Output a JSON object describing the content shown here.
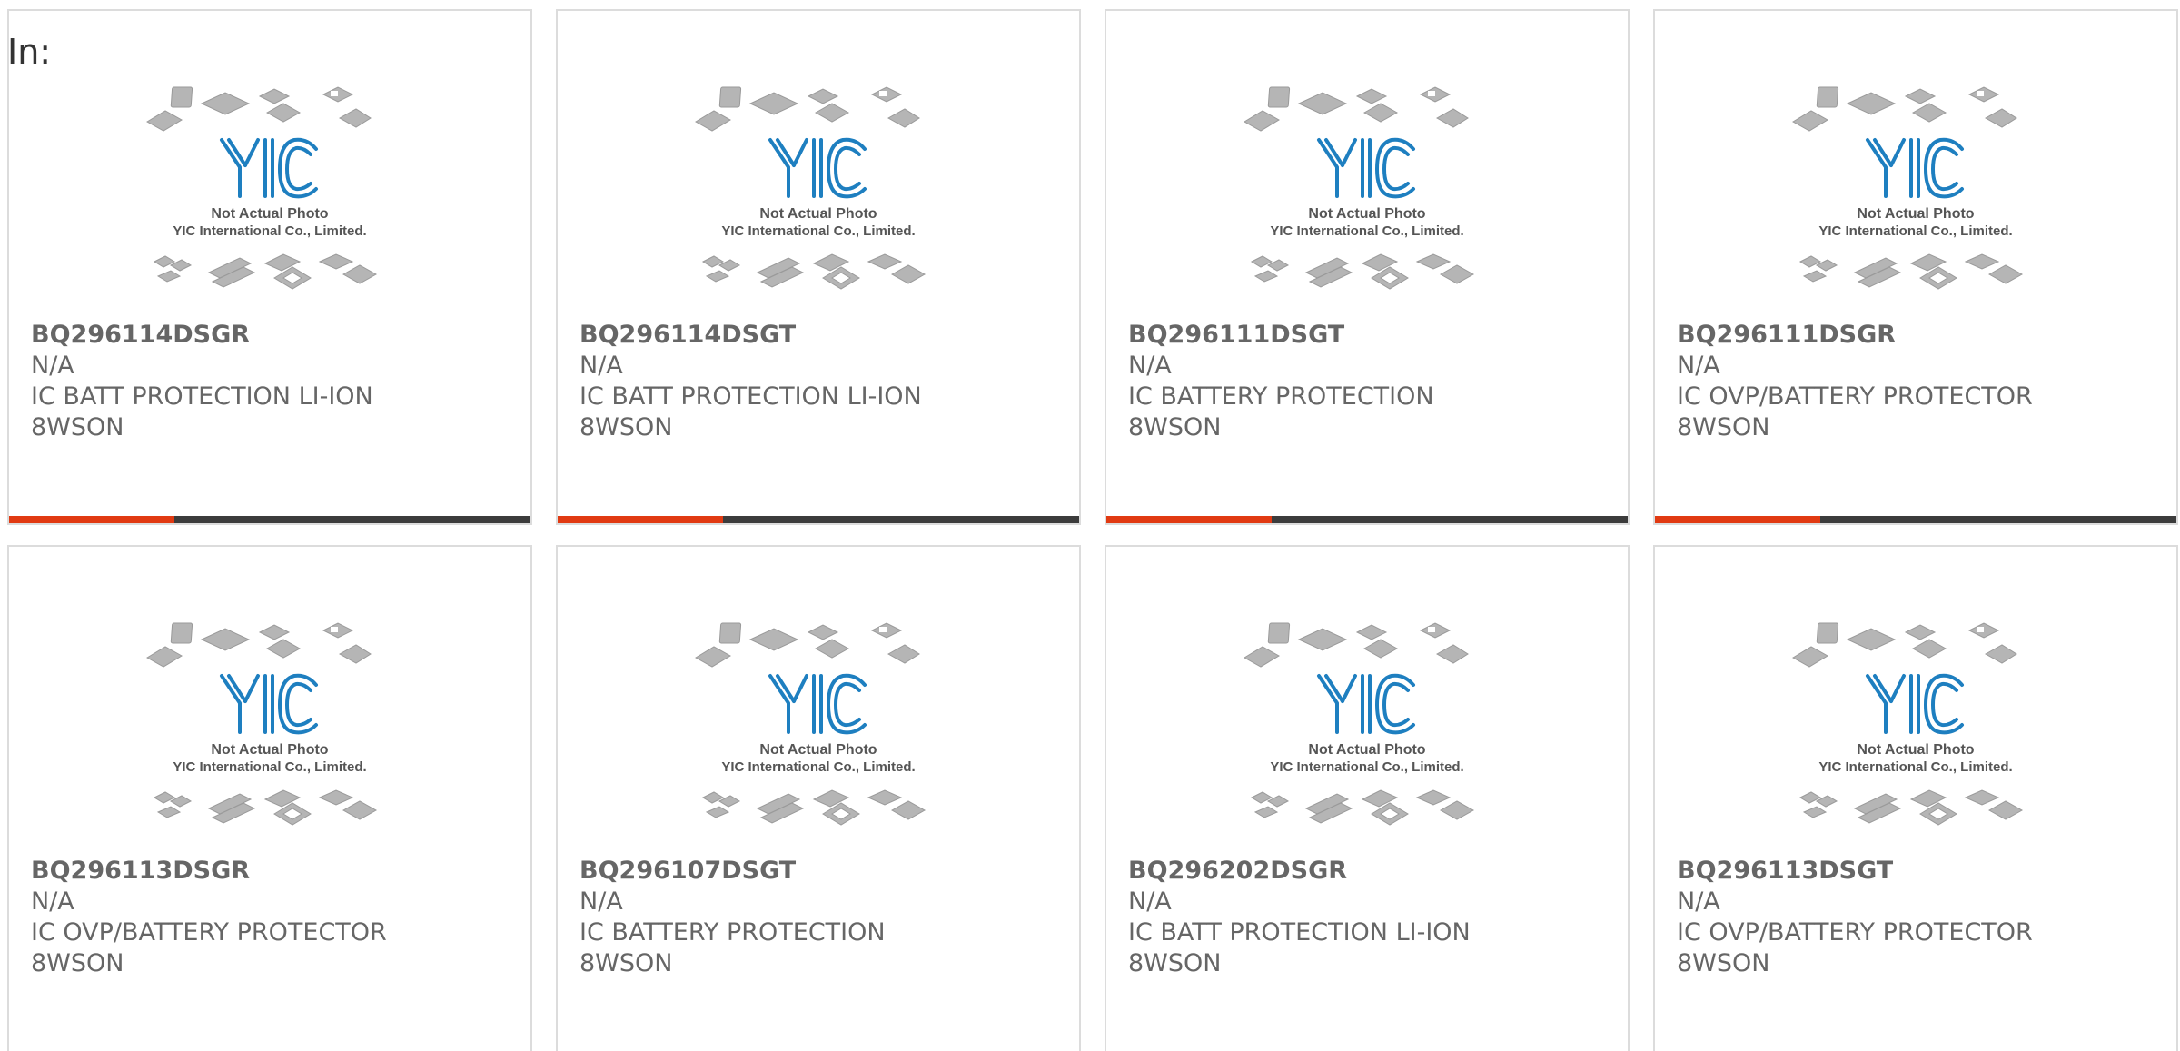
{
  "header": {
    "label": "In:"
  },
  "placeholder": {
    "caption_line1": "Not Actual Photo",
    "caption_line2": "YIC International Co., Limited.",
    "logo_text": "YIC"
  },
  "colors": {
    "accent": "#e13a12",
    "bar": "#3c3c3c",
    "logo_blue": "#1e7fc0",
    "text": "#666666"
  },
  "products": [
    {
      "part_number": "BQ296114DSGR",
      "manufacturer": "N/A",
      "description": "IC BATT PROTECTION LI-ION",
      "package": "8WSON"
    },
    {
      "part_number": "BQ296114DSGT",
      "manufacturer": "N/A",
      "description": "IC BATT PROTECTION LI-ION",
      "package": "8WSON"
    },
    {
      "part_number": "BQ296111DSGT",
      "manufacturer": "N/A",
      "description": "IC BATTERY PROTECTION",
      "package": "8WSON"
    },
    {
      "part_number": "BQ296111DSGR",
      "manufacturer": "N/A",
      "description": "IC OVP/BATTERY PROTECTOR",
      "package": "8WSON"
    },
    {
      "part_number": "BQ296113DSGR",
      "manufacturer": "N/A",
      "description": "IC OVP/BATTERY PROTECTOR",
      "package": "8WSON"
    },
    {
      "part_number": "BQ296107DSGT",
      "manufacturer": "N/A",
      "description": "IC BATTERY PROTECTION",
      "package": "8WSON"
    },
    {
      "part_number": "BQ296202DSGR",
      "manufacturer": "N/A",
      "description": "IC BATT PROTECTION LI-ION",
      "package": "8WSON"
    },
    {
      "part_number": "BQ296113DSGT",
      "manufacturer": "N/A",
      "description": "IC OVP/BATTERY PROTECTOR",
      "package": "8WSON"
    }
  ]
}
